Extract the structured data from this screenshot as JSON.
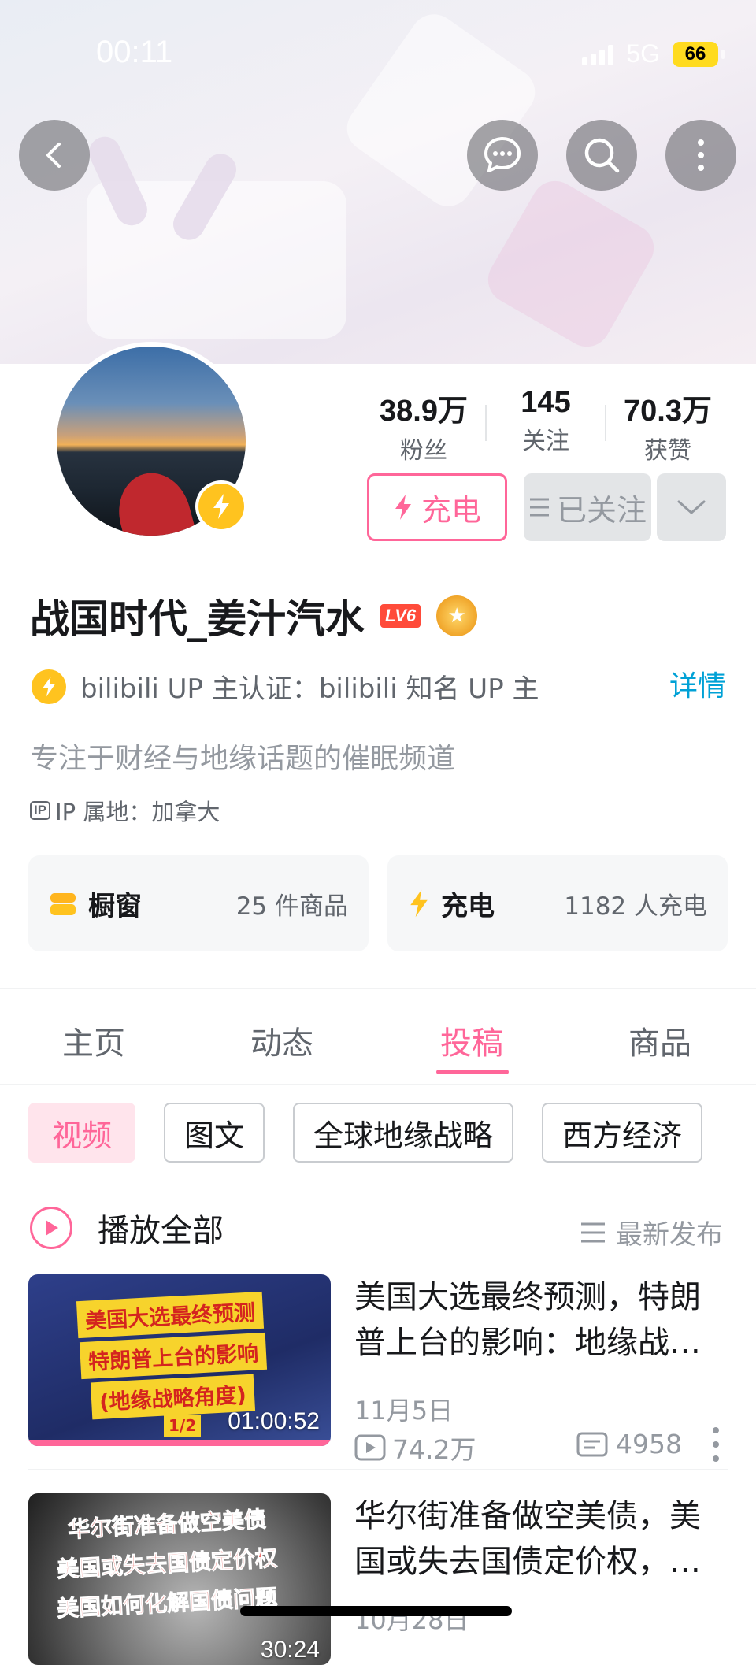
{
  "status_bar": {
    "time": "00:11",
    "network": "5G",
    "battery": "66"
  },
  "profile": {
    "name": "战国时代_姜汁汽水",
    "level": "LV6",
    "stats": [
      {
        "value": "38.9万",
        "label": "粉丝"
      },
      {
        "value": "145",
        "label": "关注"
      },
      {
        "value": "70.3万",
        "label": "获赞"
      }
    ],
    "charge_button": "充电",
    "followed_button": "已关注",
    "verification": "bilibili UP 主认证：bilibili 知名 UP 主",
    "detail_link": "详情",
    "signature": "专注于财经与地缘话题的催眠频道",
    "ip_tag": "IP",
    "ip_location": "IP 属地：加拿大"
  },
  "cards": [
    {
      "title": "橱窗",
      "meta": "25 件商品"
    },
    {
      "title": "充电",
      "meta": "1182 人充电"
    }
  ],
  "tabs": [
    "主页",
    "动态",
    "投稿",
    "商品"
  ],
  "active_tab": "投稿",
  "chips": [
    "视频",
    "图文",
    "全球地缘战略",
    "西方经济"
  ],
  "play_all": "播放全部",
  "sort": "最新发布",
  "videos": [
    {
      "title": "美国大选最终预测，特朗普上台的影响：地缘战…",
      "date": "11月5日",
      "plays": "74.2万",
      "comments": "4958",
      "duration": "01:00:52",
      "thumb_lines": [
        "美国大选最终预测",
        "特朗普上台的影响",
        "(地缘战略角度)"
      ],
      "thumb_part": "1/2"
    },
    {
      "title": "华尔街准备做空美债，美国或失去国债定价权，…",
      "date": "10月28日",
      "duration": "30:24",
      "thumb_lines": [
        "华尔街准备做空美债",
        "美国或失去国债定价权",
        "美国如何化解国债问题"
      ]
    }
  ],
  "colors": {
    "accent": "#ff6699",
    "link": "#00a1d6",
    "charge_yellow": "#ffc31f"
  }
}
